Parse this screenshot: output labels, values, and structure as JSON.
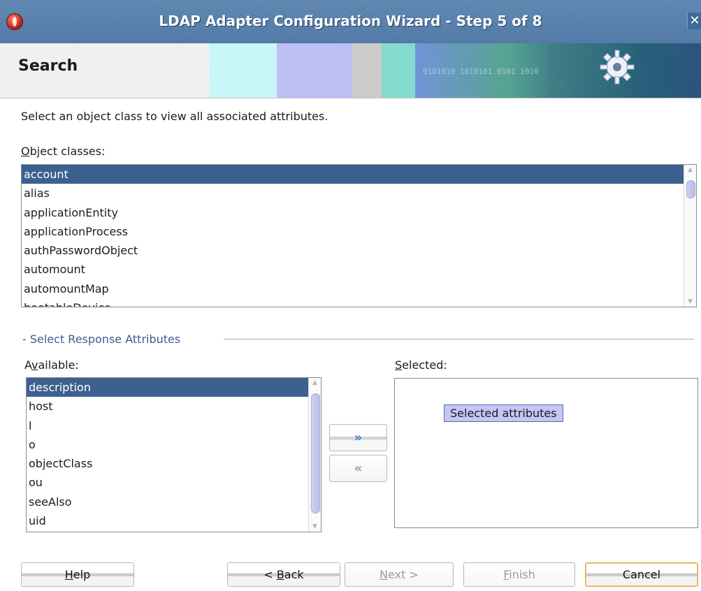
{
  "window": {
    "title": "LDAP Adapter Configuration Wizard - Step 5 of 8",
    "close_glyph": "✕"
  },
  "header": {
    "page_title": "Search",
    "banner_digits": "0101010 1010101 0101 1010"
  },
  "instructions": "Select an object class to view all associated attributes.",
  "object_classes": {
    "label_prefix": "",
    "label_mnemonic": "O",
    "label_rest": "bject classes:",
    "items": [
      "account",
      "alias",
      "applicationEntity",
      "applicationProcess",
      "authPasswordObject",
      "automount",
      "automountMap",
      "bootableDevice"
    ],
    "selected_index": 0
  },
  "response_attributes": {
    "section_title": "- Select Response Attributes",
    "available_label_prefix": "A",
    "available_label_mnemonic": "v",
    "available_label_rest": "ailable:",
    "available": [
      "description",
      "host",
      "l",
      "o",
      "objectClass",
      "ou",
      "seeAlso",
      "uid"
    ],
    "available_selected_index": 0,
    "selected_label_mnemonic": "S",
    "selected_label_rest": "elected:",
    "selected_placeholder": "Selected attributes",
    "add_glyph": "»",
    "remove_glyph": "«"
  },
  "buttons": {
    "help_mnemonic": "H",
    "help_rest": "elp",
    "back_prefix": "< ",
    "back_mnemonic": "B",
    "back_rest": "ack",
    "next_mnemonic": "N",
    "next_rest": "ext >",
    "finish_mnemonic": "F",
    "finish_rest": "inish",
    "cancel": "Cancel"
  },
  "colors": {
    "selection": "#3c618f",
    "titlebar": "#5c84b0",
    "section_title": "#3e5c8c",
    "default_button_border": "#e8a44a"
  }
}
